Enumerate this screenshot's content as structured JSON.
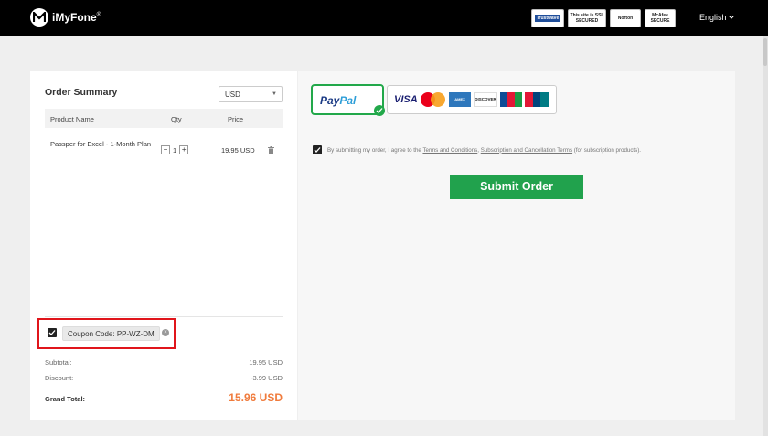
{
  "header": {
    "brand": "iMyFone",
    "brand_reg": "®",
    "badges": [
      "Trustwave",
      "This site is SSL SECURED",
      "Norton",
      "McAfee SECURE"
    ],
    "language": "English"
  },
  "order": {
    "title": "Order Summary",
    "currency": "USD",
    "columns": {
      "product": "Product Name",
      "qty": "Qty",
      "price": "Price"
    },
    "items": [
      {
        "name": "Passper for Excel - 1-Month Plan",
        "qty": "1",
        "price": "19.95 USD"
      }
    ],
    "coupon": {
      "label": "Coupon Code: PP-WZ-DM",
      "checked": true
    },
    "subtotal_label": "Subtotal:",
    "subtotal": "19.95 USD",
    "discount_label": "Discount:",
    "discount": "-3.99 USD",
    "grand_label": "Grand Total:",
    "grand_total": "15.96 USD"
  },
  "payment": {
    "paypal_p1": "Pay",
    "paypal_p2": "Pal",
    "cards": [
      "VISA",
      "Mastercard",
      "AMEX",
      "DISCOVER",
      "JCB",
      "UnionPay"
    ],
    "agree_prefix": "By submitting my order, I agree to the ",
    "terms_link": "Terms and Conditions",
    "sep": ", ",
    "sub_link": "Subscription and Cancellation Terms",
    "agree_suffix": " (for subscription products).",
    "submit_label": "Submit Order"
  },
  "colors": {
    "accent_green": "#21a24d",
    "grand_total": "#f07b3c",
    "highlight": "#e0151b"
  }
}
